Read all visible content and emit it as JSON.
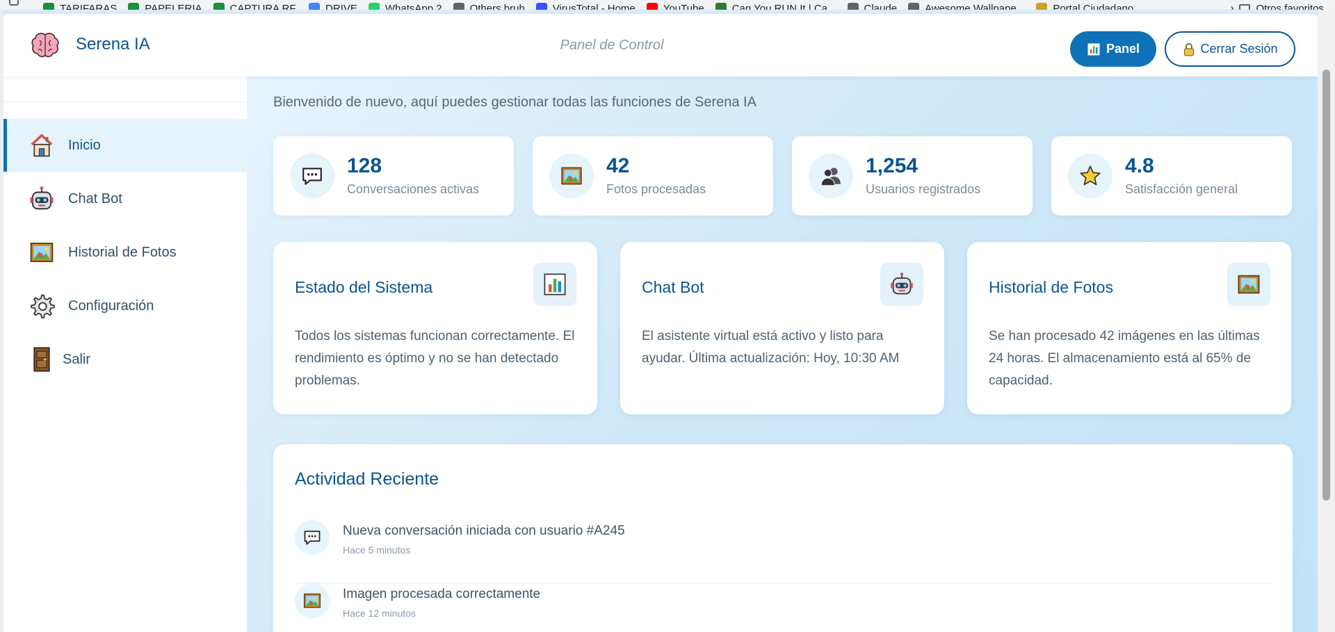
{
  "bookmarks": {
    "items": [
      {
        "label": "TARIFARAS",
        "color": "#1e8e3e"
      },
      {
        "label": "PAPELERIA",
        "color": "#1e8e3e"
      },
      {
        "label": "CAPTURA RF.",
        "color": "#1e8e3e"
      },
      {
        "label": "DRIVE",
        "color": "#4285f4"
      },
      {
        "label": "WhatsApp 2",
        "color": "#25d366"
      },
      {
        "label": "Others bruh",
        "color": "#5f6368"
      },
      {
        "label": "VirusTotal - Home",
        "color": "#394eff"
      },
      {
        "label": "YouTube",
        "color": "#ff0000"
      },
      {
        "label": "Can You RUN It | Ca...",
        "color": "#2e7d32"
      },
      {
        "label": "Claude",
        "color": "#5f6368"
      },
      {
        "label": "Awesome Wallpape...",
        "color": "#5f6368"
      },
      {
        "label": "Portal Ciudadano",
        "color": "#c9a227"
      }
    ],
    "others_label": "Otros favoritos"
  },
  "header": {
    "brand": "Serena IA",
    "subtitle": "Panel de Control",
    "panel_button": "Panel",
    "logout_button": "Cerrar Sesión"
  },
  "sidebar": {
    "items": [
      {
        "label": "Inicio",
        "icon": "house-icon",
        "active": true
      },
      {
        "label": "Chat Bot",
        "icon": "robot-icon",
        "active": false
      },
      {
        "label": "Historial de Fotos",
        "icon": "framed-picture-icon",
        "active": false
      },
      {
        "label": "Configuración",
        "icon": "gear-icon",
        "active": false
      },
      {
        "label": "Salir",
        "icon": "door-icon",
        "active": false
      }
    ]
  },
  "main": {
    "welcome": "Bienvenido de nuevo, aquí puedes gestionar todas las funciones de Serena IA",
    "stats": [
      {
        "value": "128",
        "label": "Conversaciones activas",
        "icon": "speech-bubble-icon"
      },
      {
        "value": "42",
        "label": "Fotos procesadas",
        "icon": "framed-picture-icon"
      },
      {
        "value": "1,254",
        "label": "Usuarios registrados",
        "icon": "users-icon"
      },
      {
        "value": "4.8",
        "label": "Satisfacción general",
        "icon": "star-icon"
      }
    ],
    "cards": [
      {
        "title": "Estado del Sistema",
        "icon": "bar-chart-icon",
        "body": "Todos los sistemas funcionan correctamente. El rendimiento es óptimo y no se han detectado problemas."
      },
      {
        "title": "Chat Bot",
        "icon": "robot-icon",
        "body": "El asistente virtual está activo y listo para ayudar. Última actualización: Hoy, 10:30 AM"
      },
      {
        "title": "Historial de Fotos",
        "icon": "framed-picture-icon",
        "body": "Se han procesado 42 imágenes en las últimas 24 horas. El almacenamiento está al 65% de capacidad."
      }
    ],
    "activity": {
      "title": "Actividad Reciente",
      "items": [
        {
          "text": "Nueva conversación iniciada con usuario #A245",
          "time": "Hace 5 minutos",
          "icon": "speech-bubble-icon"
        },
        {
          "text": "Imagen procesada correctamente",
          "time": "Hace 12 minutos",
          "icon": "framed-picture-icon"
        }
      ]
    }
  },
  "colors": {
    "accent": "#0f72b8",
    "brand_text": "#0b5394",
    "main_bg": "#cfe8f8"
  }
}
